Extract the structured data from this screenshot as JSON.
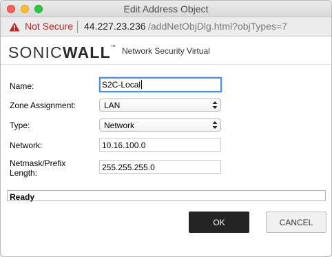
{
  "window": {
    "title": "Edit Address Object"
  },
  "address_bar": {
    "security_label": "Not Secure",
    "security_icon": "warning-triangle-icon",
    "url_host": "44.227.23.236",
    "url_path": "/addNetObjDlg.html?objTypes=7"
  },
  "header": {
    "logo_part1": "SONIC",
    "logo_part2": "WALL",
    "logo_tm": "™",
    "product_name": "Network Security Virtual"
  },
  "form": {
    "name_label": "Name:",
    "name_value": "S2C-Local",
    "zone_label": "Zone Assignment:",
    "zone_value": "LAN",
    "type_label": "Type:",
    "type_value": "Network",
    "network_label": "Network:",
    "network_value": "10.16.100.0",
    "netmask_label_line1": "Netmask/Prefix",
    "netmask_label_line2": "Length:",
    "netmask_value": "255.255.255.0"
  },
  "status": {
    "text": "Ready"
  },
  "buttons": {
    "ok": "OK",
    "cancel": "CANCEL"
  },
  "colors": {
    "not_secure": "#c5221f",
    "focus_ring": "#4a90e2",
    "ok_button": "#242424"
  }
}
